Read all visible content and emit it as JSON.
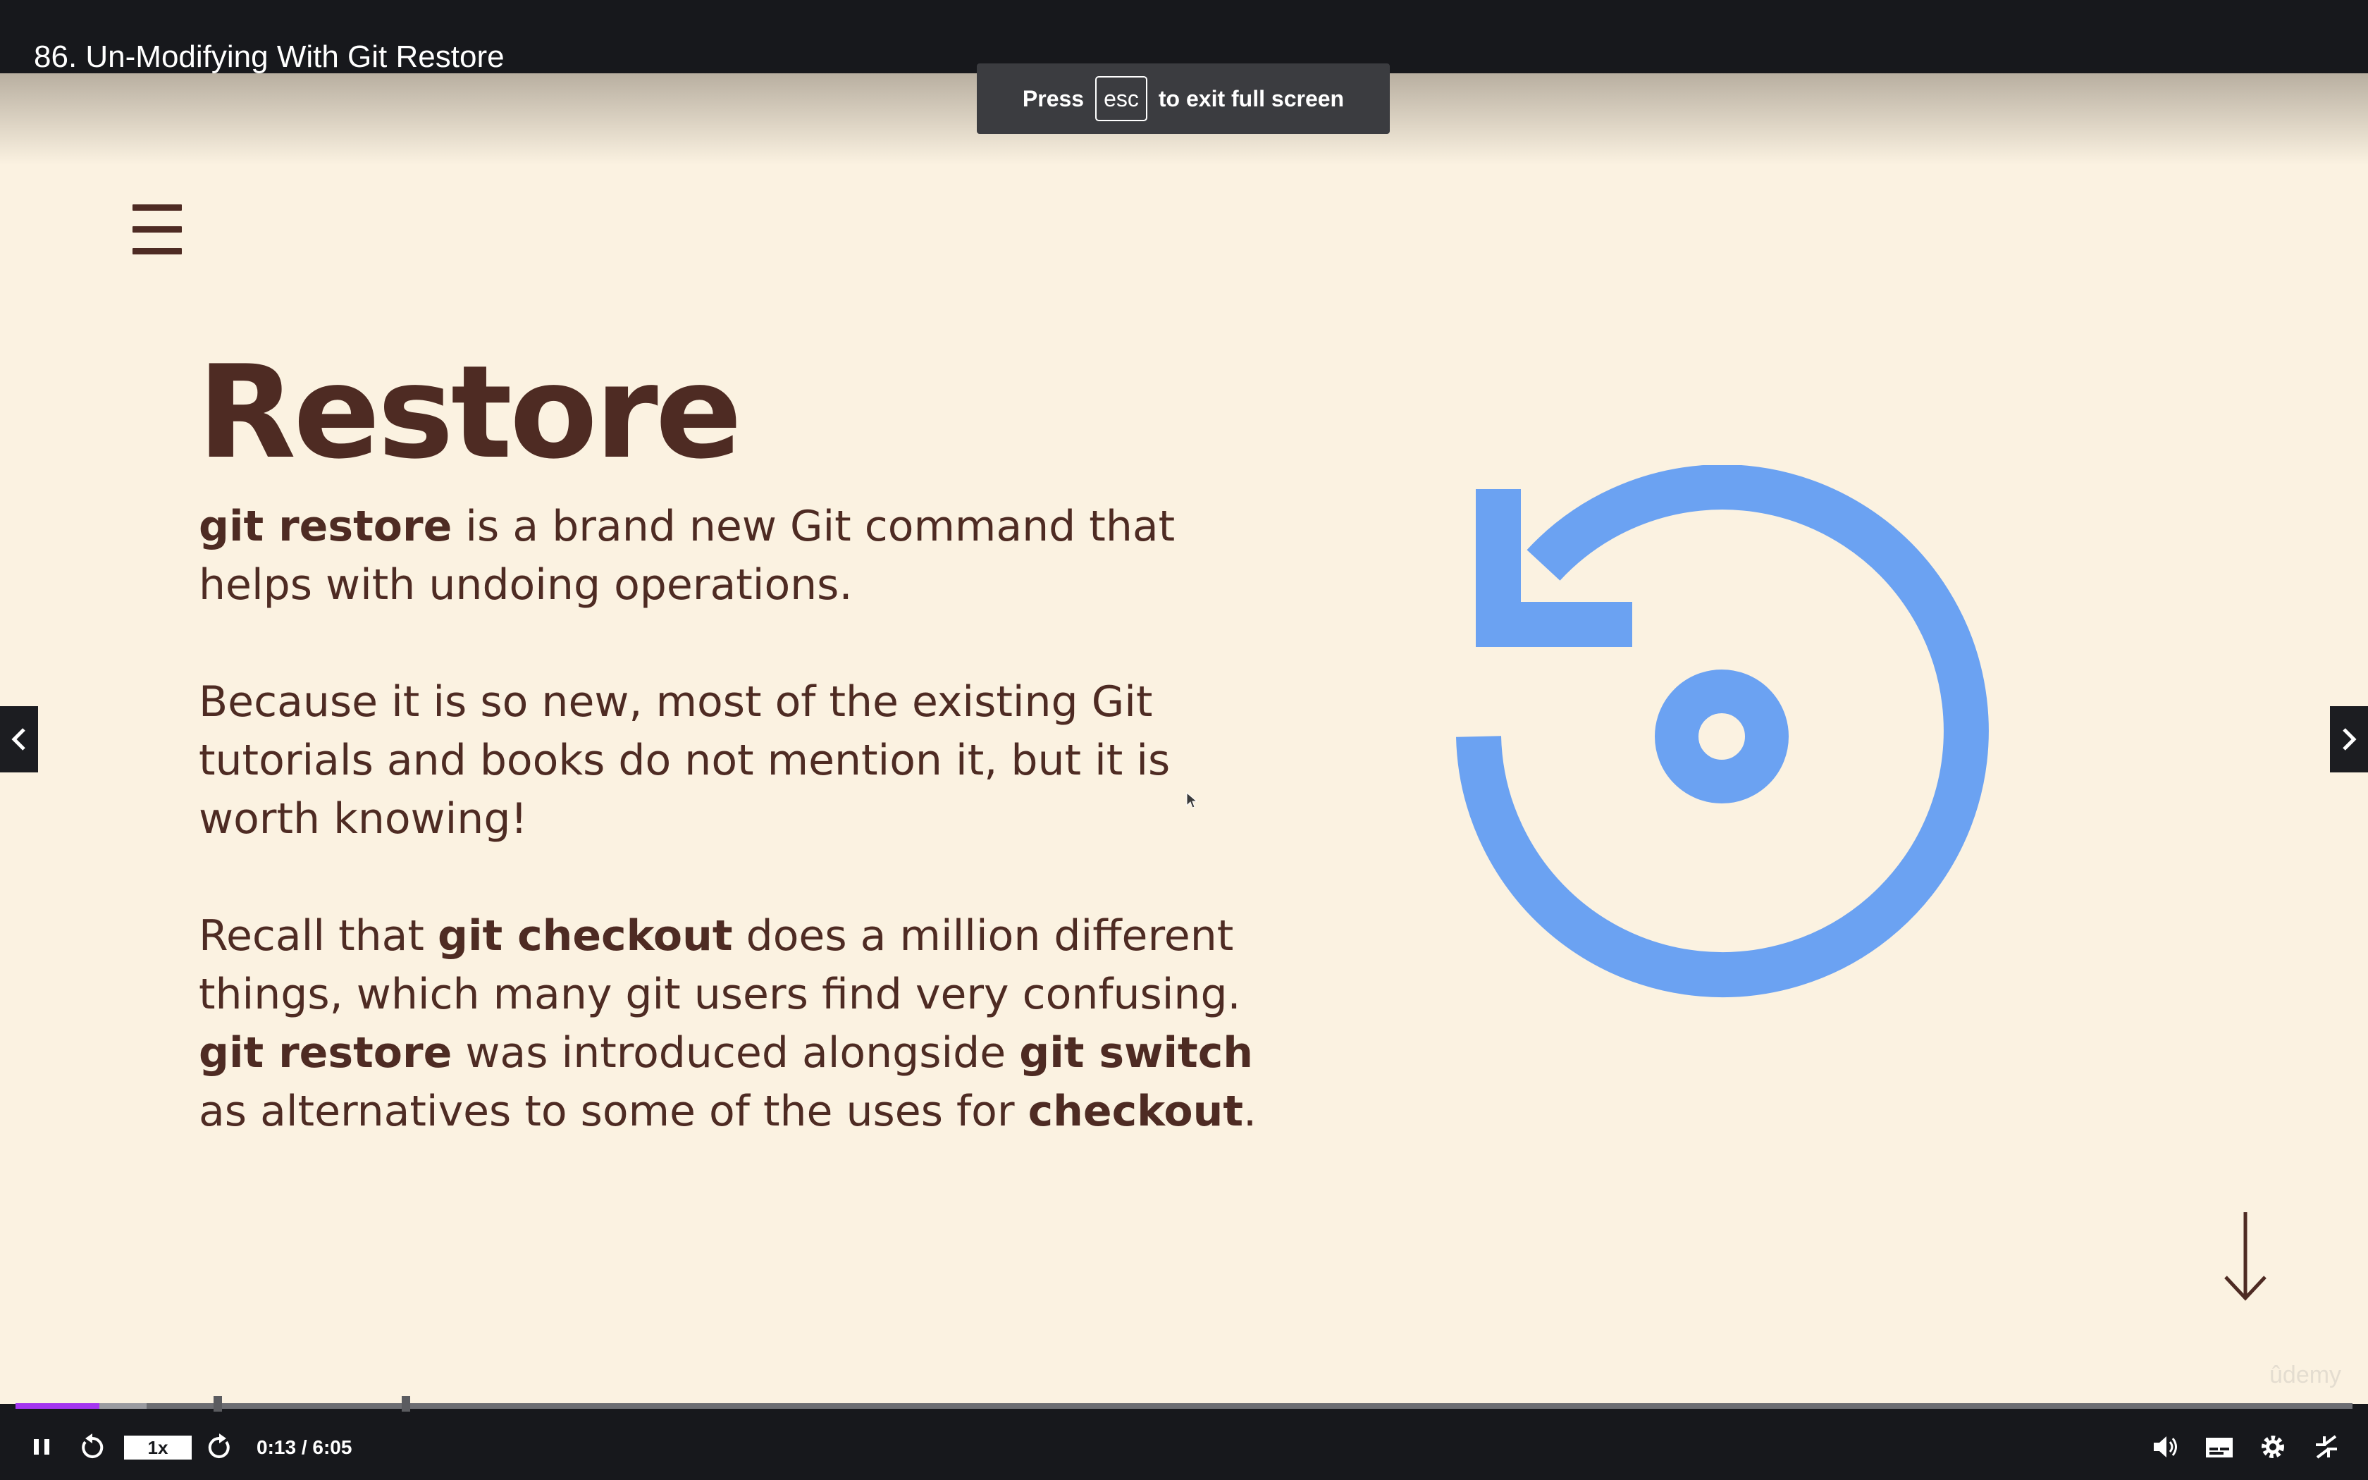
{
  "header": {
    "title": "86. Un-Modifying With Git Restore"
  },
  "fullscreen_toast": {
    "prefix": "Press",
    "key": "esc",
    "suffix": "to exit full screen"
  },
  "slide": {
    "title": "Restore",
    "paragraphs": [
      {
        "parts": [
          {
            "text": "git restore",
            "bold": true
          },
          {
            "text": " is a brand new Git command that helps with undoing operations.",
            "bold": false
          }
        ]
      },
      {
        "parts": [
          {
            "text": "Because it is so new, most of the existing Git tutorials and books do not mention it, but it is worth knowing!",
            "bold": false
          }
        ]
      },
      {
        "parts": [
          {
            "text": "Recall that ",
            "bold": false
          },
          {
            "text": "git checkout",
            "bold": true
          },
          {
            "text": " does a million different things, which many git users find very confusing. ",
            "bold": false
          },
          {
            "text": "git restore",
            "bold": true
          },
          {
            "text": " was introduced alongside ",
            "bold": false
          },
          {
            "text": "git switch",
            "bold": true
          },
          {
            "text": " as alternatives to some of the uses for ",
            "bold": false
          },
          {
            "text": "checkout",
            "bold": true
          },
          {
            "text": ".",
            "bold": false
          }
        ]
      }
    ],
    "icon": "restore-icon",
    "accent_color": "#6ba2f2",
    "text_color": "#4e2b23",
    "background_color": "#fbf2e1"
  },
  "watermark": "ûdemy",
  "player": {
    "speed": "1x",
    "time": "0:13 / 6:05",
    "progress_fraction": 0.036,
    "buffered_fraction": 0.02,
    "chapter_marker_fractions": [
      0.0867,
      0.1672
    ],
    "icons": [
      "pause-icon",
      "rewind-icon",
      "forward-icon",
      "volume-icon",
      "captions-icon",
      "settings-icon",
      "exit-fullscreen-icon"
    ],
    "progress_color": "#a435f0"
  }
}
